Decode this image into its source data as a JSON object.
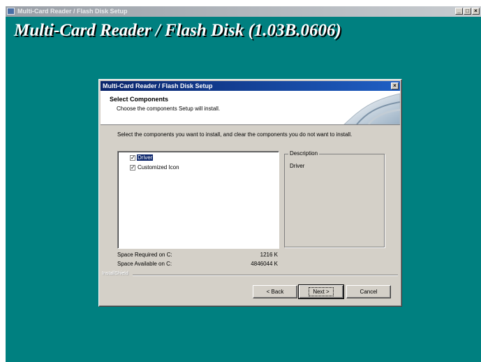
{
  "outer_window": {
    "title": "Multi-Card Reader / Flash Disk Setup",
    "controls": [
      "_",
      "□",
      "×"
    ]
  },
  "banner": {
    "text": "Multi-Card Reader / Flash Disk (1.03B.0606)"
  },
  "dialog": {
    "title": "Multi-Card Reader / Flash Disk Setup",
    "close_label": "×",
    "header": {
      "title": "Select Components",
      "subtitle": "Choose the components Setup will install."
    },
    "instruction": "Select the components you want to install, and clear the components you do not want to install.",
    "components": [
      {
        "label": "Driver",
        "checked": true,
        "selected": true
      },
      {
        "label": "Customized Icon",
        "checked": true,
        "selected": false
      }
    ],
    "description": {
      "legend": "Description",
      "text": "Driver"
    },
    "space": {
      "required_label": "Space Required on  C:",
      "required_value": "1216 K",
      "available_label": "Space Available on  C:",
      "available_value": "4846044 K"
    },
    "brand": "InstallShield",
    "buttons": {
      "back": "< Back",
      "next": "Next >",
      "cancel": "Cancel"
    }
  },
  "colors": {
    "desktop": "#008080",
    "dialog_face": "#d4d0c8",
    "title_active": "#0a246a"
  }
}
